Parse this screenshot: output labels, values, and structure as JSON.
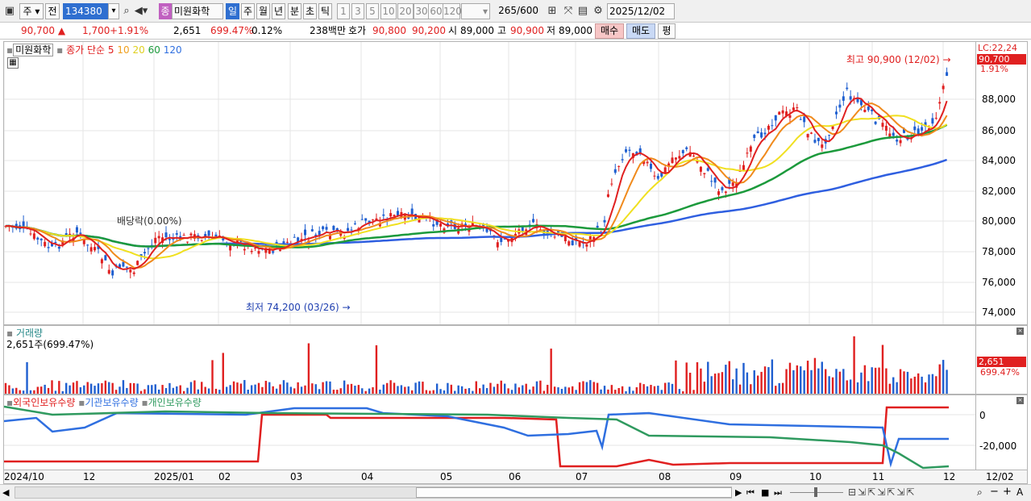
{
  "toolbar": {
    "market": "주",
    "period_type": "전",
    "code": "134380",
    "stock_name": "미원화학",
    "stock_badge": "종",
    "period_tabs": [
      "일",
      "주",
      "월",
      "년",
      "분",
      "초",
      "틱"
    ],
    "period_selected": "일",
    "interval_options": [
      "1",
      "3",
      "5",
      "10",
      "20",
      "30",
      "60",
      "120"
    ],
    "count_value": "265",
    "count_total": "/600",
    "date_value": "2025/12/02"
  },
  "infobar": {
    "price": "90,700",
    "change": "1,700",
    "change_pct": "+1.91%",
    "volume": "2,651",
    "volume_ratio": "699.47%",
    "turnover": "0.12%",
    "amount": "238백만",
    "bid_label": "호가",
    "ask_price": "90,800",
    "bid_price": "90,200",
    "open_label": "시",
    "open_value": "89,000",
    "high_label": "고",
    "high_value": "90,900",
    "low_label": "저",
    "low_value": "89,000",
    "buy_label": "매수",
    "sell_label": "매도",
    "avg_label": "평"
  },
  "price_panel": {
    "title": "미원화학",
    "ma_label": "종가 단순",
    "ma_periods": [
      "5",
      "10",
      "20",
      "60",
      "120"
    ],
    "lc_label": "LC:22,24",
    "current_price_tag": "90,700",
    "current_pct_tag": "1.91%",
    "high_annotation": "최고 90,900 (12/02)",
    "low_annotation": "최저 74,200 (03/26)",
    "overlay_note": "배당락(0.00%)",
    "y_ticks": [
      "88,000",
      "86,000",
      "84,000",
      "82,000",
      "80,000",
      "78,000",
      "76,000",
      "74,000"
    ]
  },
  "volume_panel": {
    "title": "거래량",
    "value_label": "2,651주(699.47%)",
    "tag_value": "2,651",
    "tag_pct": "699.47%"
  },
  "holding_panel": {
    "legends": [
      "외국인보유수량",
      "기관보유수량",
      "개인보유수량"
    ],
    "y_ticks": [
      "0",
      "-20,000"
    ]
  },
  "date_axis": {
    "labels": [
      "2024/10",
      "12",
      "2025/01",
      "02",
      "03",
      "04",
      "05",
      "06",
      "07",
      "08",
      "09",
      "10",
      "11",
      "12"
    ],
    "current": "12/02"
  },
  "colors": {
    "up": "#e02020",
    "down": "#1f5fd0",
    "ma5": "#e02020",
    "ma10": "#f08a1c",
    "ma20": "#f0e020",
    "ma60": "#1c9a3c",
    "ma120": "#2f5fe0",
    "foreign": "#e02020",
    "institution": "#2f6fe0",
    "individual": "#2f9a5f"
  }
}
